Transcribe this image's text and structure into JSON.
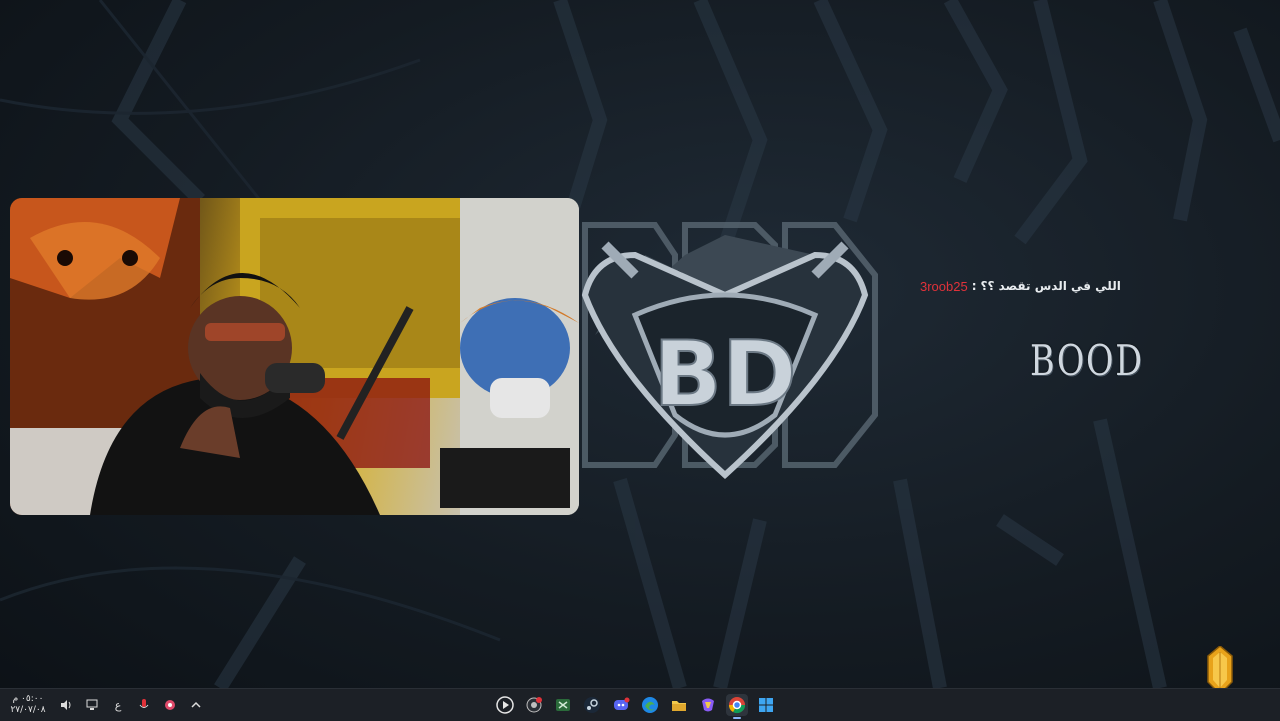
{
  "chat": {
    "username": "3roob25",
    "separator": ":",
    "message": "اللي في الدس تقصد ؟؟"
  },
  "brand": {
    "text": "BOOD"
  },
  "taskbar": {
    "clock": {
      "time": "٠٥:٠٠ م",
      "date": "٢٧/٠٧/٠٨"
    },
    "language": "ع",
    "tray_icons": [
      "speaker-icon",
      "network-icon",
      "microphone-icon",
      "app-tray-icon",
      "chevron-up-icon"
    ],
    "apps": [
      {
        "name": "media-player-app-icon"
      },
      {
        "name": "recording-app-icon"
      },
      {
        "name": "xbox-app-icon"
      },
      {
        "name": "steam-app-icon"
      },
      {
        "name": "discord-app-icon"
      },
      {
        "name": "edge-app-icon"
      },
      {
        "name": "file-explorer-app-icon"
      },
      {
        "name": "copilot-app-icon"
      },
      {
        "name": "chrome-app-icon"
      },
      {
        "name": "windows-start-icon"
      }
    ]
  },
  "colors": {
    "chat_username": "#e0323a",
    "taskbar_bg": "#1c2026",
    "wallpaper_bg": "#141b22"
  }
}
